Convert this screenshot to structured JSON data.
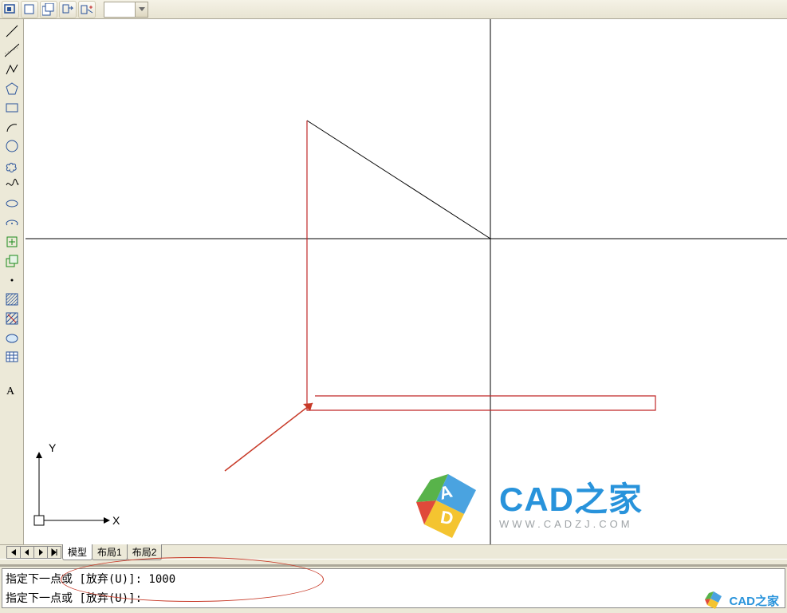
{
  "toolbar_top": {
    "icons": [
      "view-fit-icon",
      "view-zoom-window-icon",
      "view-zoom-extents-icon",
      "view-pan-icon",
      "view-regen-icon"
    ],
    "dropdown_value": ""
  },
  "toolbar_left": {
    "tools": [
      {
        "name": "line-tool",
        "label": "直线"
      },
      {
        "name": "construction-line-tool",
        "label": "构造线"
      },
      {
        "name": "polyline-tool",
        "label": "多段线"
      },
      {
        "name": "polygon-tool",
        "label": "多边形"
      },
      {
        "name": "rectangle-tool",
        "label": "矩形"
      },
      {
        "name": "arc-tool",
        "label": "圆弧"
      },
      {
        "name": "circle-tool",
        "label": "圆"
      },
      {
        "name": "revision-cloud-tool",
        "label": "修订云线"
      },
      {
        "name": "spline-tool",
        "label": "样条曲线"
      },
      {
        "name": "ellipse-tool",
        "label": "椭圆"
      },
      {
        "name": "ellipse-arc-tool",
        "label": "椭圆弧"
      },
      {
        "name": "insert-block-tool",
        "label": "插入块"
      },
      {
        "name": "make-block-tool",
        "label": "创建块"
      },
      {
        "name": "point-tool",
        "label": "点"
      },
      {
        "name": "hatch-tool",
        "label": "图案填充"
      },
      {
        "name": "gradient-tool",
        "label": "渐变色"
      },
      {
        "name": "region-tool",
        "label": "面域"
      },
      {
        "name": "table-tool",
        "label": "表格"
      },
      {
        "name": "mtext-tool",
        "label": "多行文字"
      }
    ]
  },
  "tabs": {
    "nav": {
      "first": "|◀",
      "prev": "◀",
      "next": "▶",
      "last": "▶|"
    },
    "items": [
      {
        "label": "模型",
        "active": true
      },
      {
        "label": "布局1",
        "active": false
      },
      {
        "label": "布局2",
        "active": false
      }
    ]
  },
  "command": {
    "line1": "指定下一点或 [放弃(U)]: 1000",
    "line2": "指定下一点或 [放弃(U)]:"
  },
  "axes": {
    "x_label": "X",
    "y_label": "Y"
  },
  "watermark": {
    "main": "CAD之家",
    "sub": "WWW.CADZJ.COM",
    "small": "CAD之家"
  }
}
